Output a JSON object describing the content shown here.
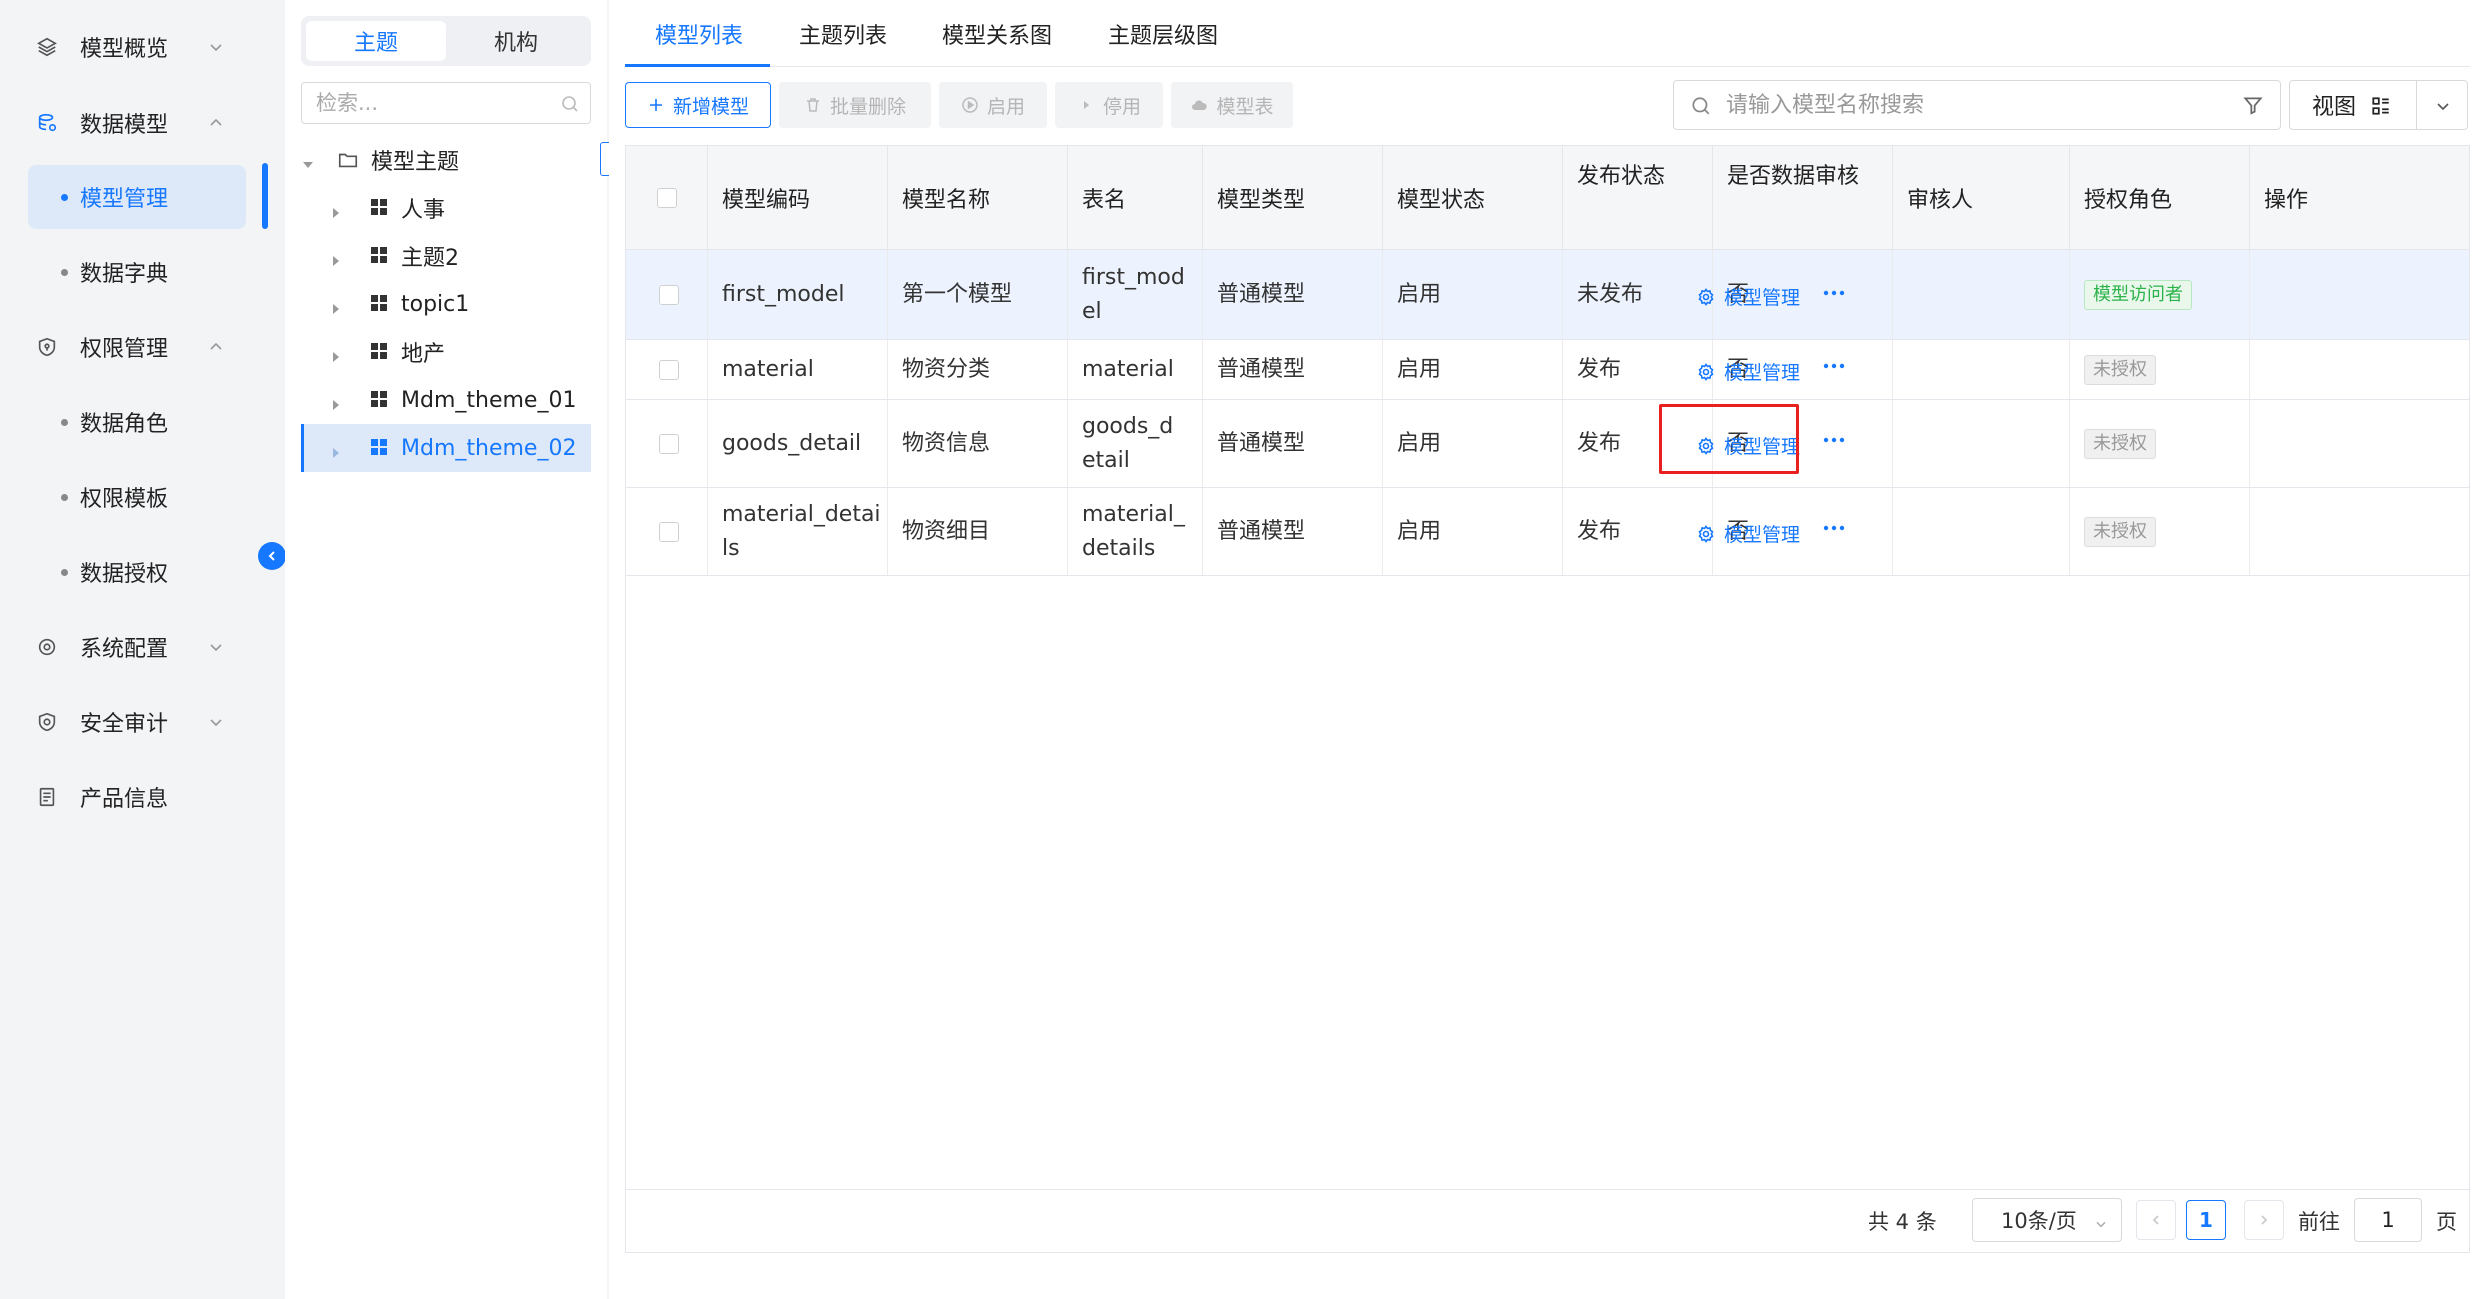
{
  "sidebar": {
    "menu": [
      {
        "label": "模型概览",
        "icon": "layers-icon",
        "expanded": false
      },
      {
        "label": "数据模型",
        "icon": "database-icon",
        "expanded": true
      },
      {
        "label": "权限管理",
        "icon": "shield-icon",
        "expanded": true
      },
      {
        "label": "系统配置",
        "icon": "gear-icon",
        "expanded": false
      },
      {
        "label": "安全审计",
        "icon": "security-icon",
        "expanded": false
      },
      {
        "label": "产品信息",
        "icon": "document-icon",
        "expanded": null
      }
    ],
    "data_model_sub": [
      {
        "label": "模型管理",
        "active": true
      },
      {
        "label": "数据字典",
        "active": false
      }
    ],
    "permission_sub": [
      {
        "label": "数据角色"
      },
      {
        "label": "权限模板"
      },
      {
        "label": "数据授权"
      }
    ]
  },
  "tree": {
    "segments": [
      "主题",
      "机构"
    ],
    "active_segment": "主题",
    "search_placeholder": "检索...",
    "root": "模型主题",
    "nodes": [
      "人事",
      "主题2",
      "topic1",
      "地产",
      "Mdm_theme_01",
      "Mdm_theme_02"
    ],
    "selected": "Mdm_theme_02"
  },
  "tabs": [
    {
      "label": "模型列表",
      "active": true
    },
    {
      "label": "主题列表"
    },
    {
      "label": "模型关系图"
    },
    {
      "label": "主题层级图"
    }
  ],
  "toolbar": {
    "add": "新增模型",
    "batch_delete": "批量删除",
    "enable": "启用",
    "disable": "停用",
    "model_table": "模型表",
    "search_placeholder": "请输入模型名称搜索",
    "view_label": "视图"
  },
  "table": {
    "columns": [
      "模型编码",
      "模型名称",
      "表名",
      "模型类型",
      "模型状态",
      "发布状态",
      "是否数据审核",
      "审核人",
      "授权角色",
      "操作"
    ],
    "rows": [
      {
        "code": [
          "first_model"
        ],
        "name": "第一个模型",
        "table": [
          "first_mod",
          "el"
        ],
        "type": "普通模型",
        "status": "启用",
        "publish": "未发布",
        "audit": "否",
        "auditor": "",
        "role": "模型访问者",
        "role_style": "green",
        "op": "模型管理"
      },
      {
        "code": [
          "material"
        ],
        "name": "物资分类",
        "table": [
          "material"
        ],
        "type": "普通模型",
        "status": "启用",
        "publish": "发布",
        "audit": "否",
        "auditor": "",
        "role": "未授权",
        "role_style": "grey",
        "op": "模型管理"
      },
      {
        "code": [
          "goods_detail"
        ],
        "name": "物资信息",
        "table": [
          "goods_d",
          "etail"
        ],
        "type": "普通模型",
        "status": "启用",
        "publish": "发布",
        "audit": "否",
        "auditor": "",
        "role": "未授权",
        "role_style": "grey",
        "op": "模型管理"
      },
      {
        "code": [
          "material_detai",
          "ls"
        ],
        "name": "物资细目",
        "table": [
          "material_",
          "details"
        ],
        "type": "普通模型",
        "status": "启用",
        "publish": "发布",
        "audit": "否",
        "auditor": "",
        "role": "未授权",
        "role_style": "grey",
        "op": "模型管理"
      }
    ]
  },
  "pagination": {
    "total": "共 4 条",
    "page_size": "10条/页",
    "current_page": "1",
    "goto_label": "前往",
    "goto_value": "1",
    "unit": "页"
  },
  "colors": {
    "accent": "#1677ff",
    "highlight": "#e8201e"
  }
}
